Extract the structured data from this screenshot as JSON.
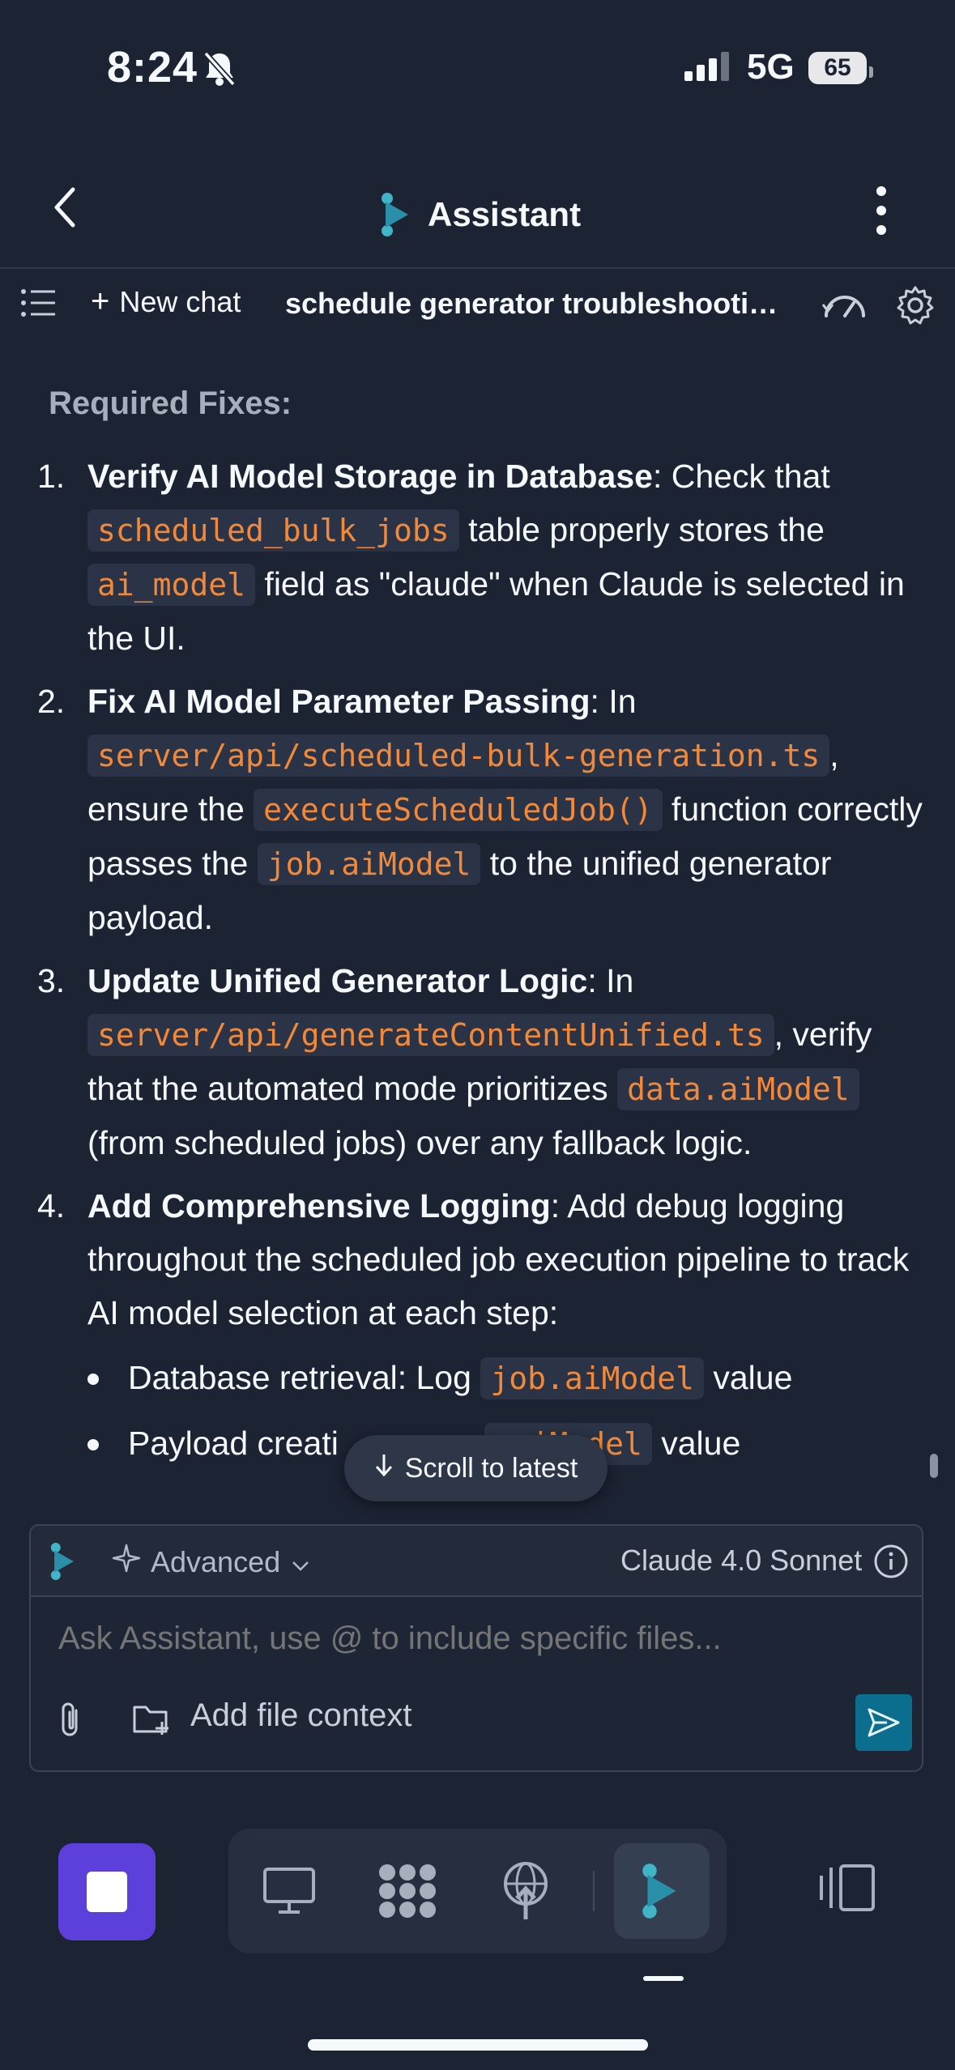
{
  "status_bar": {
    "time": "8:24",
    "network": "5G",
    "battery": "65"
  },
  "header": {
    "title": "Assistant"
  },
  "toolbar": {
    "new_chat": "New chat",
    "chat_title": "schedule generator troubleshooting ..."
  },
  "content": {
    "heading": "Required Fixes:",
    "items": [
      {
        "num": "1.",
        "bold": "Verify AI Model Storage in Database",
        "t1": ": Check that ",
        "c1": "scheduled_bulk_jobs",
        "t2": " table properly stores the ",
        "c2": "ai_model",
        "t3": " field as \"claude\" when Claude is selected in the UI."
      },
      {
        "num": "2.",
        "bold": "Fix AI Model Parameter Passing",
        "t1": ": In ",
        "c1": "server/api/scheduled-bulk-generation.ts",
        "t2": ", ensure the ",
        "c2": "executeScheduledJob()",
        "t3": " function correctly passes the ",
        "c3": "job.aiModel",
        "t4": " to the unified generator payload."
      },
      {
        "num": "3.",
        "bold": "Update Unified Generator Logic",
        "t1": ": In ",
        "c1": "server/api/generateContentUnified.ts",
        "t2": ", verify that the automated mode prioritizes ",
        "c2": "data.aiModel",
        "t3": " (from scheduled jobs) over any fallback logic."
      },
      {
        "num": "4.",
        "bold": "Add Comprehensive Logging",
        "t1": ": Add debug logging throughout the scheduled job execution pipeline to track AI model selection at each step:",
        "sub": [
          {
            "text": "Database retrieval: Log ",
            "code": "job.aiModel",
            "after": " value"
          },
          {
            "text": "Payload creati",
            "code": ".aiModel",
            "after": " value"
          }
        ]
      }
    ]
  },
  "scroll_pill": "Scroll to latest",
  "composer": {
    "mode": "Advanced",
    "model": "Claude 4.0 Sonnet",
    "placeholder": "Ask Assistant, use @ to include specific files...",
    "add_context": "Add file context"
  },
  "colors": {
    "accent": "#0b6e8f",
    "stop": "#5d3fdc",
    "code": "#f2893a",
    "background": "#1c2333"
  }
}
